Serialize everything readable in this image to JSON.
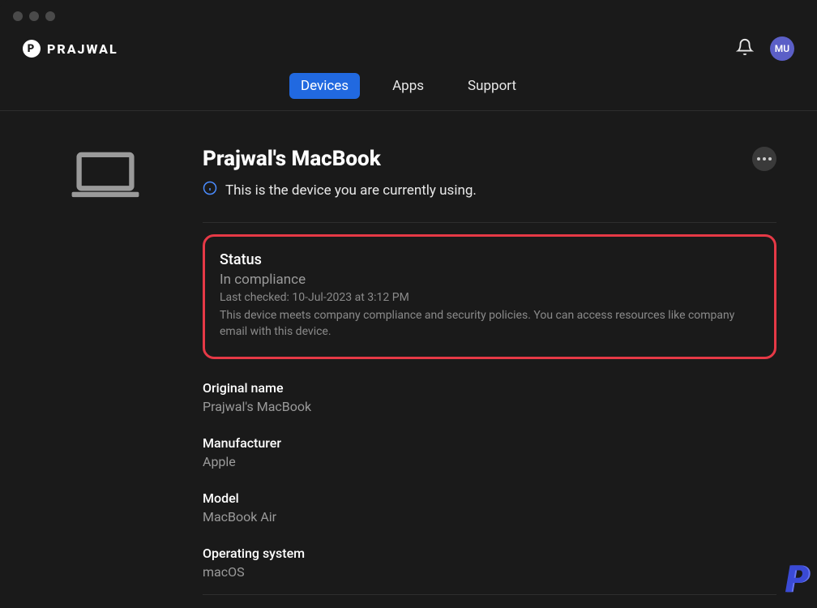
{
  "brand": {
    "name": "PRAJWAL",
    "logo_letter": "P"
  },
  "header": {
    "avatar_initials": "MU"
  },
  "tabs": [
    {
      "label": "Devices",
      "active": true
    },
    {
      "label": "Apps",
      "active": false
    },
    {
      "label": "Support",
      "active": false
    }
  ],
  "device": {
    "title": "Prajwal's MacBook",
    "current_device_note": "This is the device you are currently using."
  },
  "status": {
    "label": "Status",
    "value": "In compliance",
    "last_checked": "Last checked: 10-Jul-2023 at 3:12 PM",
    "description": "This device meets company compliance and security policies. You can access resources like company email with this device."
  },
  "fields": {
    "original_name": {
      "label": "Original name",
      "value": "Prajwal's MacBook"
    },
    "manufacturer": {
      "label": "Manufacturer",
      "value": "Apple"
    },
    "model": {
      "label": "Model",
      "value": "MacBook Air"
    },
    "operating_system": {
      "label": "Operating system",
      "value": "macOS"
    }
  },
  "watermark": "P"
}
